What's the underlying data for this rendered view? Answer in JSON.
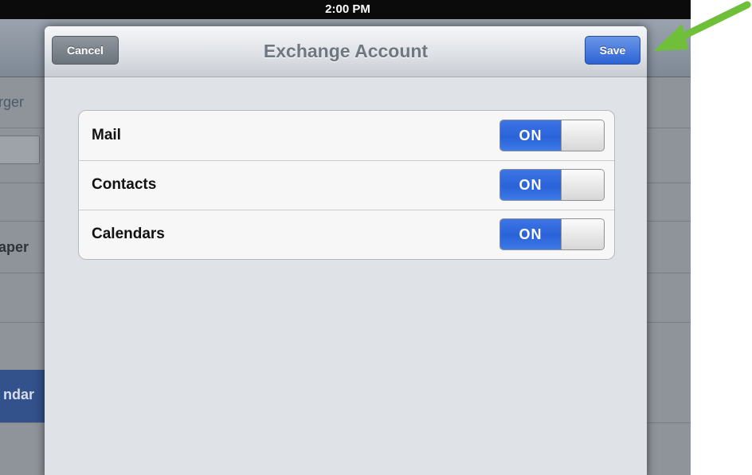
{
  "status_bar": {
    "time": "2:00 PM"
  },
  "background": {
    "fragments": [
      "rger",
      "aper",
      "ndar"
    ]
  },
  "sheet": {
    "title": "Exchange Account",
    "cancel_label": "Cancel",
    "save_label": "Save",
    "rows": [
      {
        "label": "Mail",
        "toggle": "ON"
      },
      {
        "label": "Contacts",
        "toggle": "ON"
      },
      {
        "label": "Calendars",
        "toggle": "ON"
      }
    ]
  },
  "colors": {
    "accent": "#2a63d9",
    "annotation_arrow": "#6fbf3a"
  },
  "annotation": {
    "icon": "green-arrow-icon"
  }
}
